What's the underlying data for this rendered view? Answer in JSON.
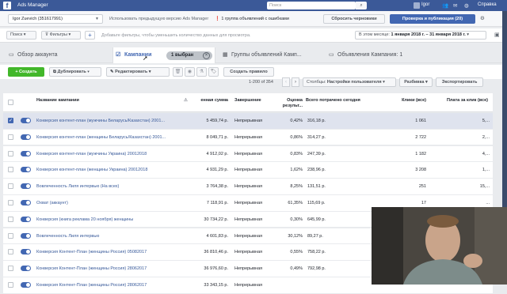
{
  "topbar": {
    "logo": "f",
    "title": "Ads Manager",
    "search_placeholder": "Поиск",
    "user": "Igor",
    "help": "Справка"
  },
  "account": {
    "selected": "Igor Zuevich (351617991)",
    "notice": "Использовать предыдущую версию Ads Manager",
    "warning": "1 группа объявлений с ошибками",
    "drafts_button": "Сбросить черновики",
    "publish_button": "Проверка и публикация (20)",
    "publish_count": "20"
  },
  "filters": {
    "search_chip": "Поиск",
    "filters_chip": "Фильтры",
    "hint": "Добавьте фильтры, чтобы уменьшить количество данных для просмотра.",
    "date_label": "В этом месяце:",
    "date_range": "1 января 2018 г. – 31 января 2018 г."
  },
  "tabs": [
    {
      "label": "Обзор аккаунта"
    },
    {
      "label": "Кампании"
    },
    {
      "label": "Группы объявлений Камп..."
    },
    {
      "label": "Объявления Кампания: 1"
    }
  ],
  "selected_badge": "1 выбран",
  "toolbar": {
    "create": "+ Создать",
    "duplicate": "Дублировать",
    "edit": "Редактировать",
    "create_rule": "Создать правило",
    "count": "1-200 of 354",
    "columns_label": "Столбцы:",
    "columns_value": "Настройки пользователя",
    "breakdown": "Разбивка",
    "export": "Экспортировать"
  },
  "table": {
    "headers": [
      "Название кампании",
      "енная сумма",
      "Завершение",
      "Оценка результ...",
      "Всего потрачено сегодня",
      "Клики (все)",
      "Плата за клик (все)"
    ],
    "rows": [
      {
        "name": "Конверсия контент-план (мужчины Беларусь/Казахстан) 2001...",
        "amount": "5 459,74 р.",
        "end": "Непрерывная",
        "result": "0,42%",
        "spent": "316,18 р.",
        "clicks": "1 061",
        "cpc": "5,..."
      },
      {
        "name": "Конверсия контент-план (женщины Беларусь/Казахстан) 2001...",
        "amount": "8 049,71 р.",
        "end": "Непрерывная",
        "result": "0,86%",
        "spent": "314,27 р.",
        "clicks": "2 722",
        "cpc": "2,..."
      },
      {
        "name": "Конверсия контент-план (мужчины Украина) 20012018",
        "amount": "4 912,02 р.",
        "end": "Непрерывная",
        "result": "0,83%",
        "spent": "247,39 р.",
        "clicks": "1 182",
        "cpc": "4,..."
      },
      {
        "name": "Конверсия контент-план (женщины Украина) 20012018",
        "amount": "4 931,29 р.",
        "end": "Непрерывная",
        "result": "1,62%",
        "spent": "238,96 р.",
        "clicks": "3 208",
        "cpc": "1,..."
      },
      {
        "name": "Вовлеченность Лиля интервью (На всех)",
        "amount": "3 764,38 р.",
        "end": "Непрерывная",
        "result": "8,25%",
        "spent": "131,51 р.",
        "clicks": "251",
        "cpc": "15,..."
      },
      {
        "name": "Охват (аккаунт)",
        "amount": "7 118,91 р.",
        "end": "Непрерывная",
        "result": "61,35%",
        "spent": "115,69 р.",
        "clicks": "17",
        "cpc": "..."
      },
      {
        "name": "Конверсия (книга реклама 20 ноября) женщины",
        "amount": "30 734,22 р.",
        "end": "Непрерывная",
        "result": "0,30%",
        "spent": "645,99 р.",
        "clicks": "",
        "cpc": ""
      },
      {
        "name": "Вовлеченность Лиля интервью",
        "amount": "4 601,83 р.",
        "end": "Непрерывная",
        "result": "30,12%",
        "spent": "89,27 р.",
        "clicks": "",
        "cpc": ""
      },
      {
        "name": "Конверсия Контент-План (женщины Россия) 05082017",
        "amount": "36 810,46 р.",
        "end": "Непрерывная",
        "result": "0,55%",
        "spent": "758,22 р.",
        "clicks": "",
        "cpc": ""
      },
      {
        "name": "Конверсия Контент-План (женщины Россия) 28062017",
        "amount": "36 976,60 р.",
        "end": "Непрерывная",
        "result": "0,49%",
        "spent": "792,98 р.",
        "clicks": "",
        "cpc": ""
      },
      {
        "name": "Конверсия Контент-План (женщины Россия) 28062017",
        "amount": "33 343,15 р.",
        "end": "Непрерывная",
        "result": "",
        "spent": "",
        "clicks": "",
        "cpc": ""
      }
    ]
  },
  "colors": {
    "brand": "#3b5998",
    "accent": "#4267b2",
    "green": "#42b72a",
    "selected_row": "#dfe3ee"
  }
}
